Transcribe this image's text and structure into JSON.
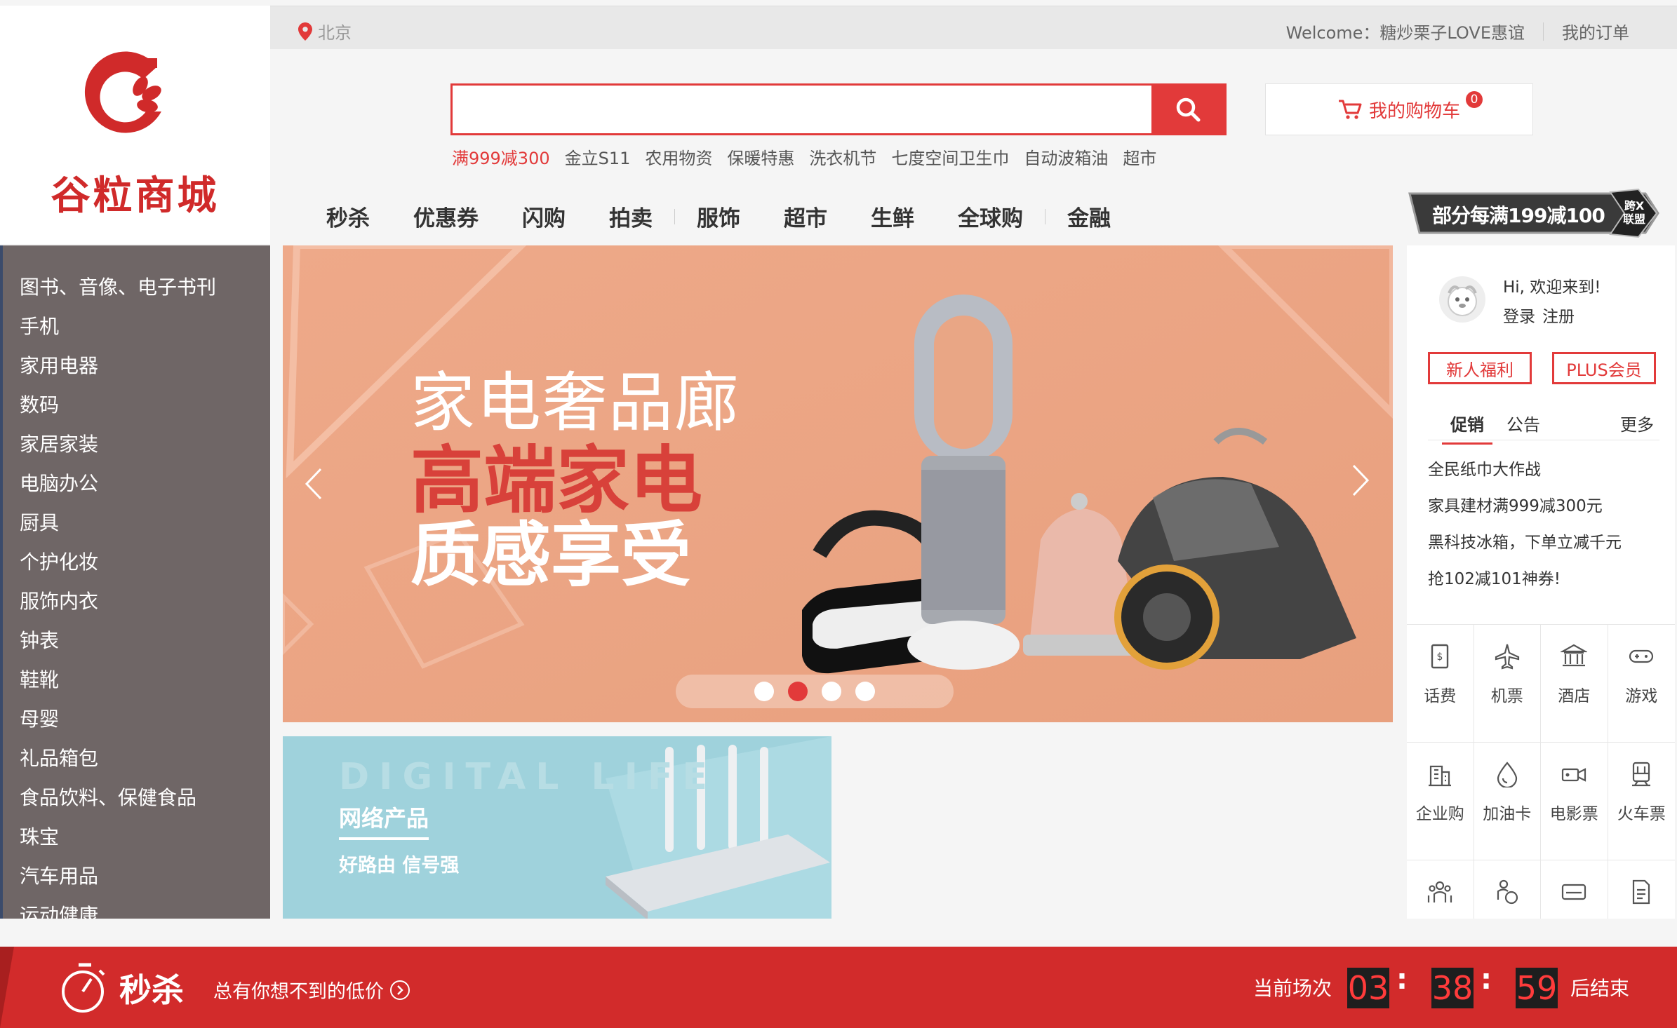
{
  "top": {
    "location": "北京",
    "welcome": "Welcome：糖炒栗子LOVE惠谊",
    "my_orders": "我的订单"
  },
  "logo": {
    "name": "谷粒商城"
  },
  "search": {
    "placeholder": ""
  },
  "hotwords": [
    "满999减300",
    "金立S11",
    "农用物资",
    "保暖特惠",
    "洗衣机节",
    "七度空间卫生巾",
    "自动波箱油",
    "超市"
  ],
  "cart": {
    "label": "我的购物车",
    "count": "0"
  },
  "nav": [
    "秒杀",
    "优惠券",
    "闪购",
    "拍卖",
    "服饰",
    "超市",
    "生鲜",
    "全球购",
    "金融"
  ],
  "promo_badge": {
    "text": "部分每满199减100",
    "tag": "跨X联盟"
  },
  "sidebar": {
    "categories": [
      "图书、音像、电子书刊",
      "手机",
      "家用电器",
      "数码",
      "家居家装",
      "电脑办公",
      "厨具",
      "个护化妆",
      "服饰内衣",
      "钟表",
      "鞋靴",
      "母婴",
      "礼品箱包",
      "食品饮料、保健食品",
      "珠宝",
      "汽车用品",
      "运动健康"
    ]
  },
  "banner": {
    "line1": "家电奢品廊",
    "line2": "高端家电",
    "line3": "质感享受",
    "active_dot": 2,
    "dot_count": 4
  },
  "sub_banner": {
    "watermark": "DIGITAL LIFE",
    "title": "网络产品",
    "subtitle": "好路由 信号强"
  },
  "user_panel": {
    "greeting": "Hi, 欢迎来到!",
    "login": "登录",
    "register": "注册",
    "newbie": "新人福利",
    "plus": "PLUS会员"
  },
  "tabs": {
    "promo": "促销",
    "notice": "公告",
    "more": "更多"
  },
  "news": [
    "全民纸巾大作战",
    "家具建材满999减300元",
    "黑科技冰箱，下单立减千元",
    "抢102减101神券!"
  ],
  "services": [
    {
      "label": "话费",
      "icon": "phone-bill-icon"
    },
    {
      "label": "机票",
      "icon": "plane-icon"
    },
    {
      "label": "酒店",
      "icon": "hotel-icon"
    },
    {
      "label": "游戏",
      "icon": "gamepad-icon"
    },
    {
      "label": "企业购",
      "icon": "building-icon"
    },
    {
      "label": "加油卡",
      "icon": "fuel-drop-icon"
    },
    {
      "label": "电影票",
      "icon": "movie-camera-icon"
    },
    {
      "label": "火车票",
      "icon": "train-icon"
    },
    {
      "label": "",
      "icon": "group-icon"
    },
    {
      "label": "",
      "icon": "person-coin-icon"
    },
    {
      "label": "",
      "icon": "card-icon"
    },
    {
      "label": "",
      "icon": "document-icon"
    }
  ],
  "seckill": {
    "title": "秒杀",
    "subtitle": "总有你想不到的低价",
    "current_label": "当前场次",
    "hours": "03",
    "minutes": "38",
    "seconds": "59",
    "end_label": "后结束"
  },
  "colors": {
    "brand_red": "#e23a3a",
    "sidebar_bg": "#6f6666",
    "seckill_bg": "#d22b2b"
  }
}
